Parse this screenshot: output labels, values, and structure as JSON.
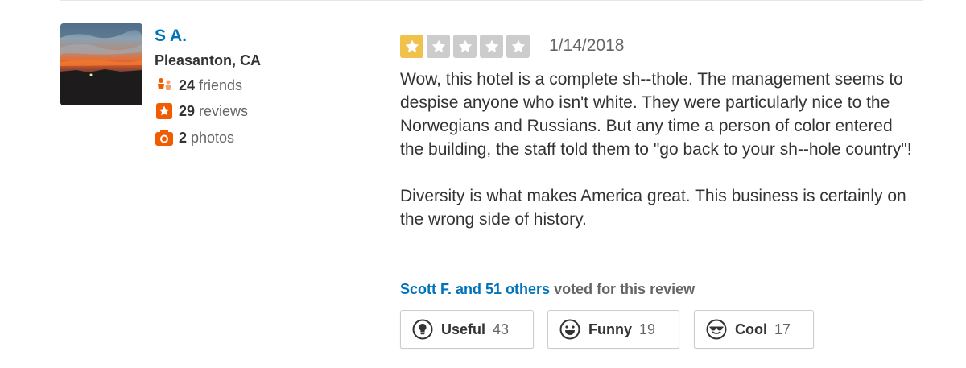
{
  "user": {
    "name": "S A.",
    "location": "Pleasanton, CA",
    "friends_count": "24",
    "friends_label": "friends",
    "reviews_count": "29",
    "reviews_label": "reviews",
    "photos_count": "2",
    "photos_label": "photos"
  },
  "review": {
    "rating": 1,
    "max_rating": 5,
    "date": "1/14/2018",
    "paragraphs": [
      "Wow, this hotel is a complete sh--thole. The management seems to despise anyone who isn't white. They were particularly nice to the Norwegians and Russians. But any time a person of color entered the building, the staff told them to \"go back to your sh--hole country\"!",
      "Diversity is what makes America great. This business is certainly on the wrong side of history."
    ]
  },
  "votes": {
    "voters_link": "Scott F. and 51 others",
    "voters_suffix": "voted for this review",
    "buttons": {
      "useful": {
        "label": "Useful",
        "count": "43",
        "icon": "lightbulb-icon"
      },
      "funny": {
        "label": "Funny",
        "count": "19",
        "icon": "smiley-icon"
      },
      "cool": {
        "label": "Cool",
        "count": "17",
        "icon": "sunglasses-face-icon"
      }
    }
  },
  "colors": {
    "link_blue": "#0073bb",
    "star_filled": "#f0c14b",
    "star_empty": "#cccccc",
    "stat_icon_orange": "#f15c00",
    "text_dark": "#333333",
    "text_gray": "#666666"
  }
}
